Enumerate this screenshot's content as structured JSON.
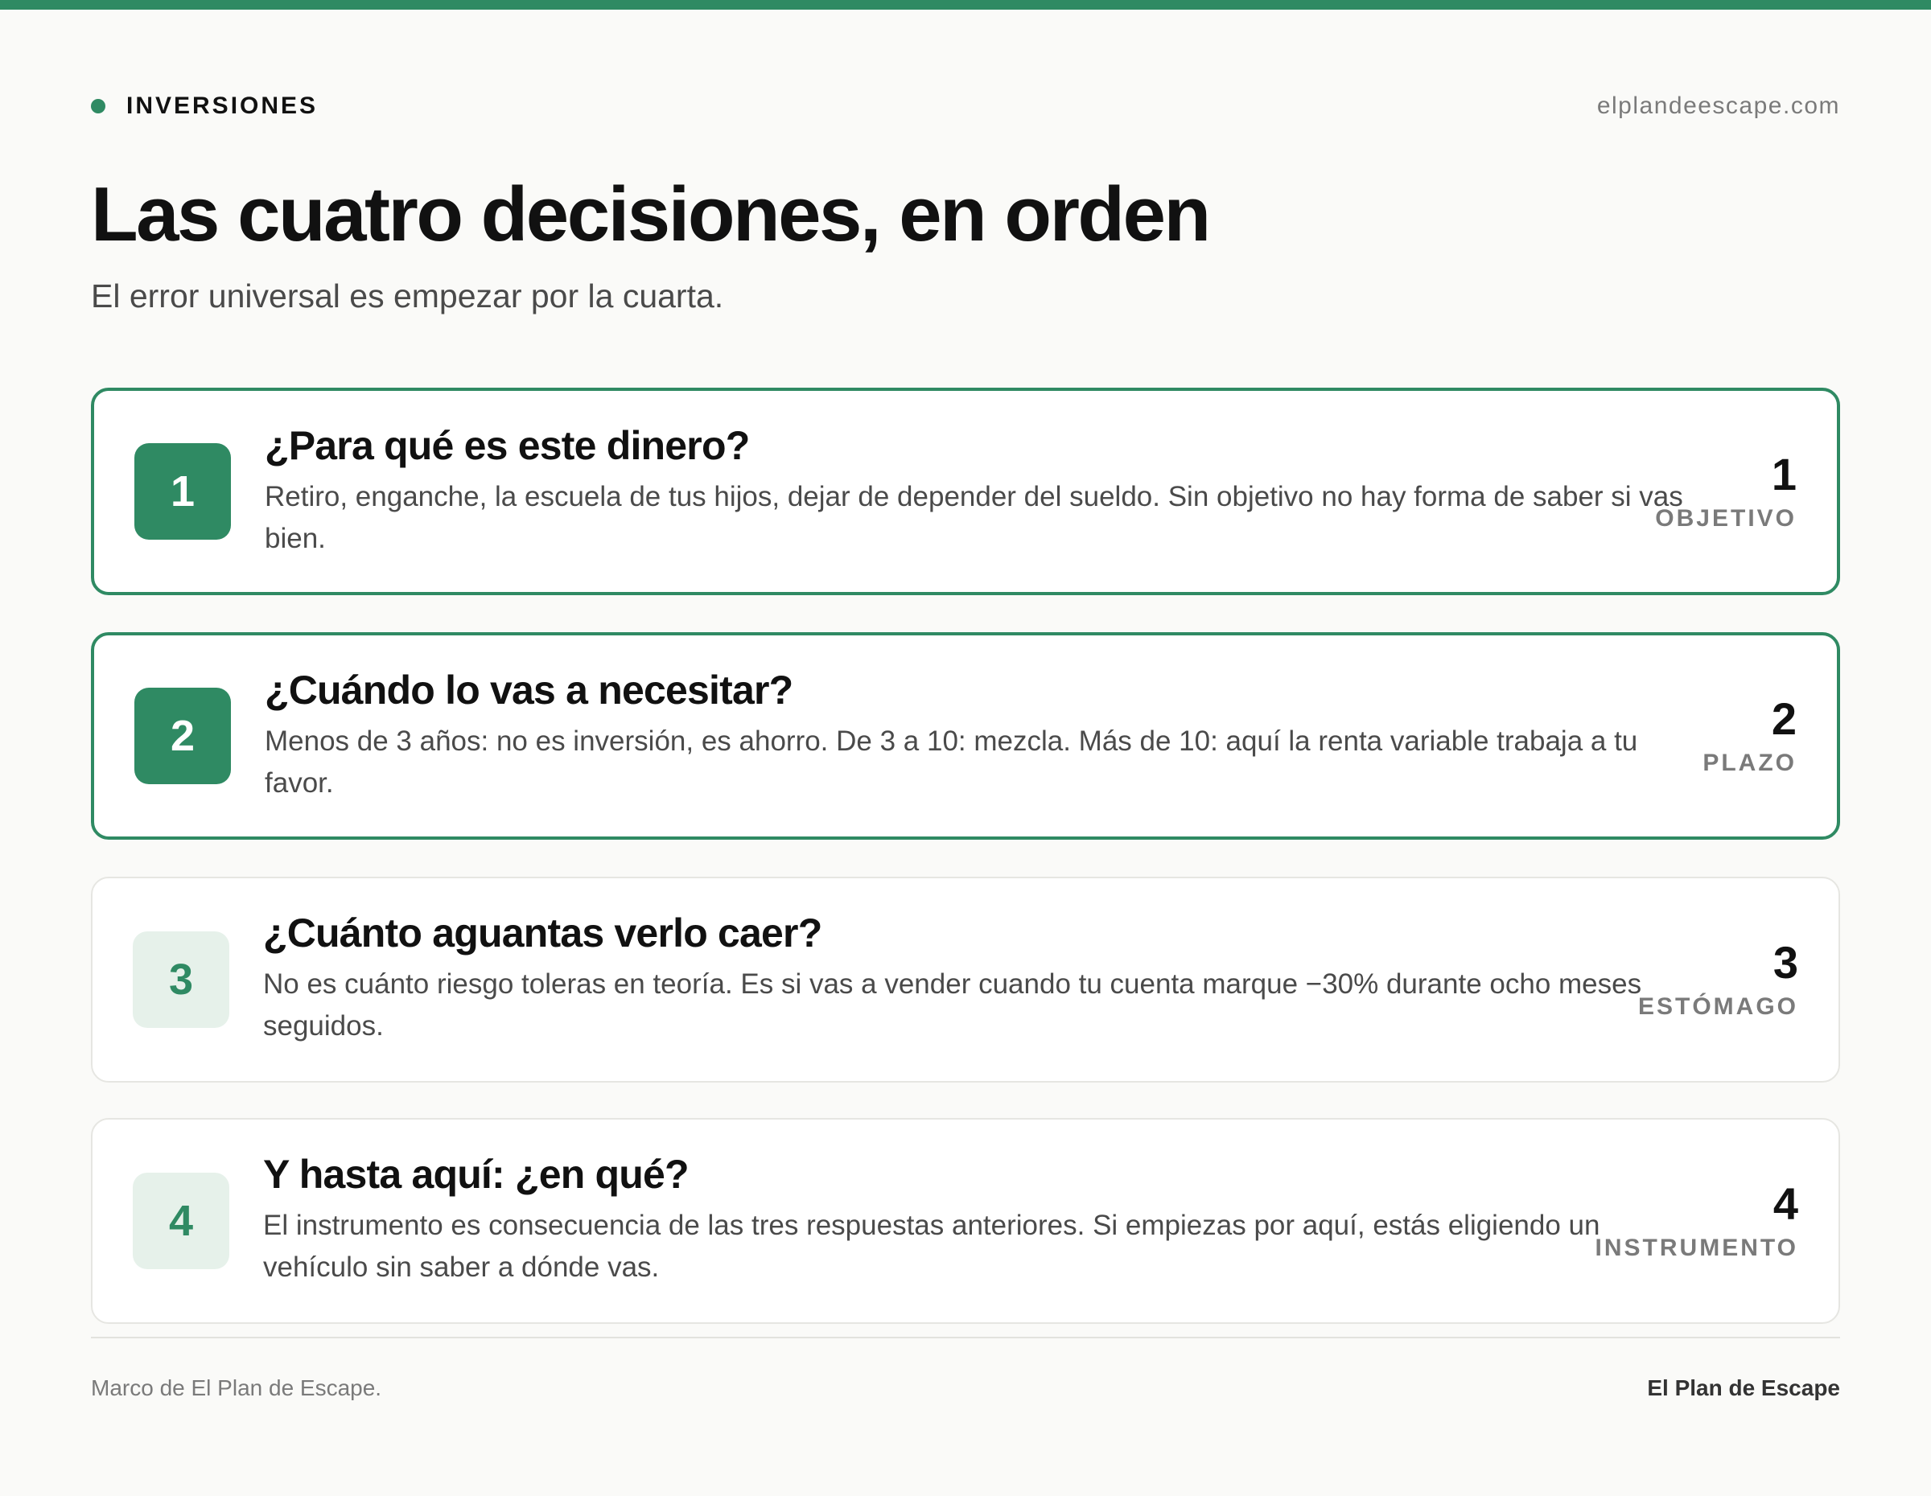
{
  "header": {
    "section": "INVERSIONES",
    "site": "elplandeescape.com"
  },
  "title": "Las cuatro decisiones, en orden",
  "subtitle": "El error universal es empezar por la cuarta.",
  "colors": {
    "accent": "#2f8a63",
    "accent_soft": "#e6f1ea",
    "text": "#111111",
    "muted_text": "#7a7a7a"
  },
  "steps": [
    {
      "number": "1",
      "title": "¿Para qué es este dinero?",
      "description": "Retiro, enganche, la escuela de tus hijos, dejar de depender del sueldo. Sin objetivo no hay forma de saber si vas bien.",
      "meta_number": "1",
      "meta_label": "OBJETIVO"
    },
    {
      "number": "2",
      "title": "¿Cuándo lo vas a necesitar?",
      "description": "Menos de 3 años: no es inversión, es ahorro. De 3 a 10: mezcla. Más de 10: aquí la renta variable trabaja a tu favor.",
      "meta_number": "2",
      "meta_label": "PLAZO"
    },
    {
      "number": "3",
      "title": "¿Cuánto aguantas verlo caer?",
      "description": "No es cuánto riesgo toleras en teoría. Es si vas a vender cuando tu cuenta marque −30% durante ocho meses seguidos.",
      "meta_number": "3",
      "meta_label": "ESTÓMAGO"
    },
    {
      "number": "4",
      "title": "Y hasta aquí: ¿en qué?",
      "description": "El instrumento es consecuencia de las tres respuestas anteriores. Si empiezas por aquí, estás eligiendo un vehículo sin saber a dónde vas.",
      "meta_number": "4",
      "meta_label": "INSTRUMENTO"
    }
  ],
  "footer": {
    "source": "Marco de El Plan de Escape.",
    "brand": "El Plan de Escape"
  }
}
